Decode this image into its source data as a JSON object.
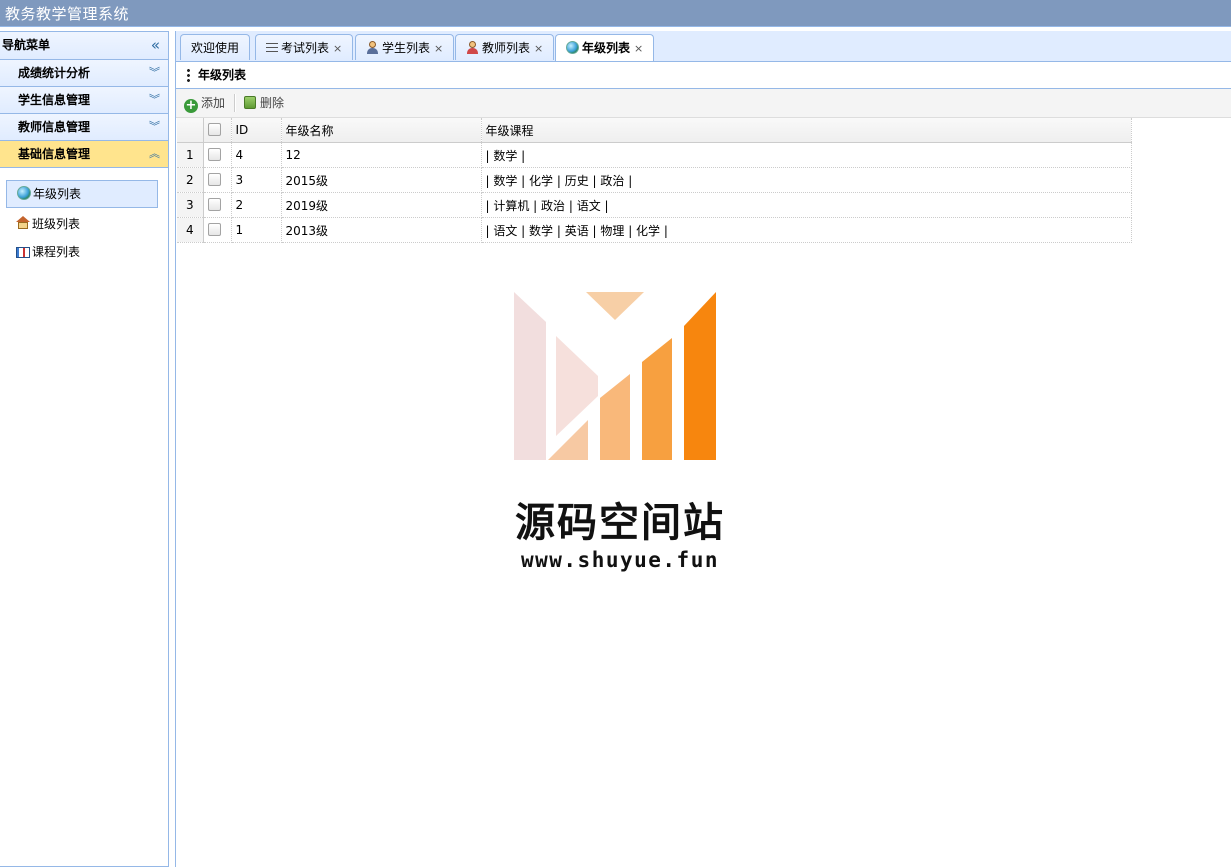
{
  "app": {
    "title": "教务教学管理系统"
  },
  "sidebar": {
    "header": "导航菜单",
    "collapse_icon": "«",
    "accordion": [
      {
        "label": "成绩统计分析",
        "icon": "chevron-double-down",
        "active": false
      },
      {
        "label": "学生信息管理",
        "icon": "chevron-double-down",
        "active": false
      },
      {
        "label": "教师信息管理",
        "icon": "chevron-double-down",
        "active": false
      },
      {
        "label": "基础信息管理",
        "icon": "chevron-double-up",
        "active": true
      }
    ],
    "tree": [
      {
        "label": "年级列表",
        "icon": "globe-icon",
        "selected": true
      },
      {
        "label": "班级列表",
        "icon": "house-icon",
        "selected": false
      },
      {
        "label": "课程列表",
        "icon": "book-icon",
        "selected": false
      }
    ]
  },
  "tabs": [
    {
      "label": "欢迎使用",
      "closable": false
    },
    {
      "label": "考试列表",
      "icon": "list-icon",
      "closable": true
    },
    {
      "label": "学生列表",
      "icon": "student-icon",
      "closable": true
    },
    {
      "label": "教师列表",
      "icon": "teacher-icon",
      "closable": true
    },
    {
      "label": "年级列表",
      "icon": "globe-icon",
      "closable": true,
      "active": true
    }
  ],
  "panel": {
    "title": "年级列表"
  },
  "toolbar": {
    "add_label": "添加",
    "delete_label": "删除"
  },
  "grid": {
    "columns": [
      "ID",
      "年级名称",
      "年级课程"
    ],
    "rows": [
      {
        "rownum": "1",
        "id": "4",
        "name": "12",
        "courses": "| 数学 |"
      },
      {
        "rownum": "2",
        "id": "3",
        "name": "2015级",
        "courses": "| 数学 | 化学 | 历史 | 政治 |"
      },
      {
        "rownum": "3",
        "id": "2",
        "name": "2019级",
        "courses": "| 计算机 | 政治 | 语文 |"
      },
      {
        "rownum": "4",
        "id": "1",
        "name": "2013级",
        "courses": "| 语文 | 数学 | 英语 | 物理 | 化学 |"
      }
    ]
  },
  "watermark": {
    "name": "源码空间站",
    "url": "www.shuyue.fun"
  },
  "colors": {
    "border": "#95b8e7",
    "header_bg": "#e0ecff",
    "active_accordion": "#ffe48d",
    "title_bar": "#7f99be"
  }
}
